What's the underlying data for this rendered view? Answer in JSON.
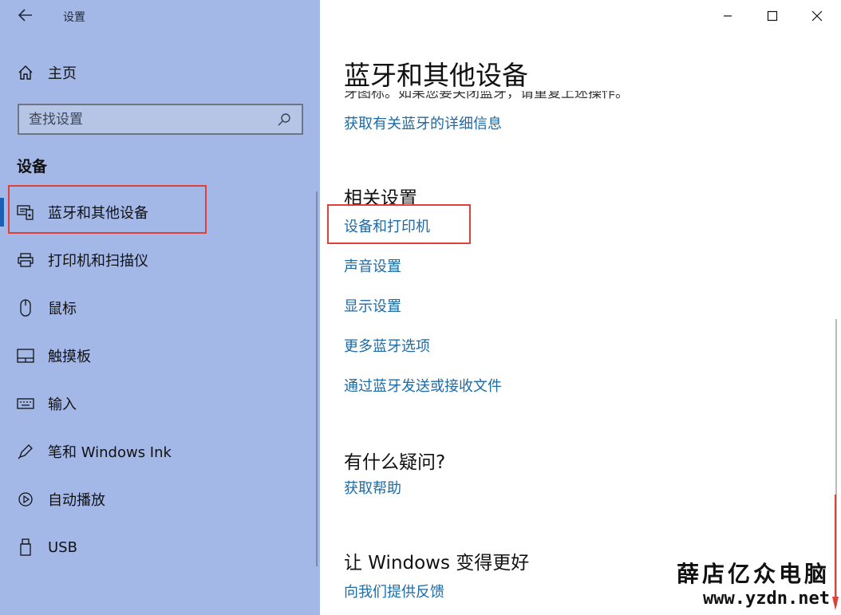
{
  "window": {
    "title": "设置"
  },
  "sidebar": {
    "home_label": "主页",
    "search_placeholder": "查找设置",
    "section_label": "设备",
    "items": [
      {
        "label": "蓝牙和其他设备",
        "icon": "bluetooth-devices-icon",
        "active": true
      },
      {
        "label": "打印机和扫描仪",
        "icon": "printer-icon"
      },
      {
        "label": "鼠标",
        "icon": "mouse-icon"
      },
      {
        "label": "触摸板",
        "icon": "touchpad-icon"
      },
      {
        "label": "输入",
        "icon": "keyboard-icon"
      },
      {
        "label": "笔和 Windows Ink",
        "icon": "pen-icon"
      },
      {
        "label": "自动播放",
        "icon": "autoplay-icon"
      },
      {
        "label": "USB",
        "icon": "usb-icon"
      }
    ]
  },
  "main": {
    "page_title": "蓝牙和其他设备",
    "cut_text": "牙图标。如果您要关闭蓝牙，请重复上述操作。",
    "bluetooth_more_info_link": "获取有关蓝牙的详细信息",
    "related": {
      "heading": "相关设置",
      "links": [
        "设备和打印机",
        "声音设置",
        "显示设置",
        "更多蓝牙选项",
        "通过蓝牙发送或接收文件"
      ]
    },
    "questions": {
      "heading": "有什么疑问?",
      "link": "获取帮助"
    },
    "feedback": {
      "heading": "让 Windows 变得更好",
      "link": "向我们提供反馈"
    }
  },
  "watermark": {
    "line1": "薛店亿众电脑",
    "line2": "www.yzdn.net"
  },
  "colors": {
    "sidebar_bg": "#a4b8e8",
    "link": "#1d6aa5",
    "accent": "#1a5fb4",
    "highlight": "#e0403a"
  }
}
